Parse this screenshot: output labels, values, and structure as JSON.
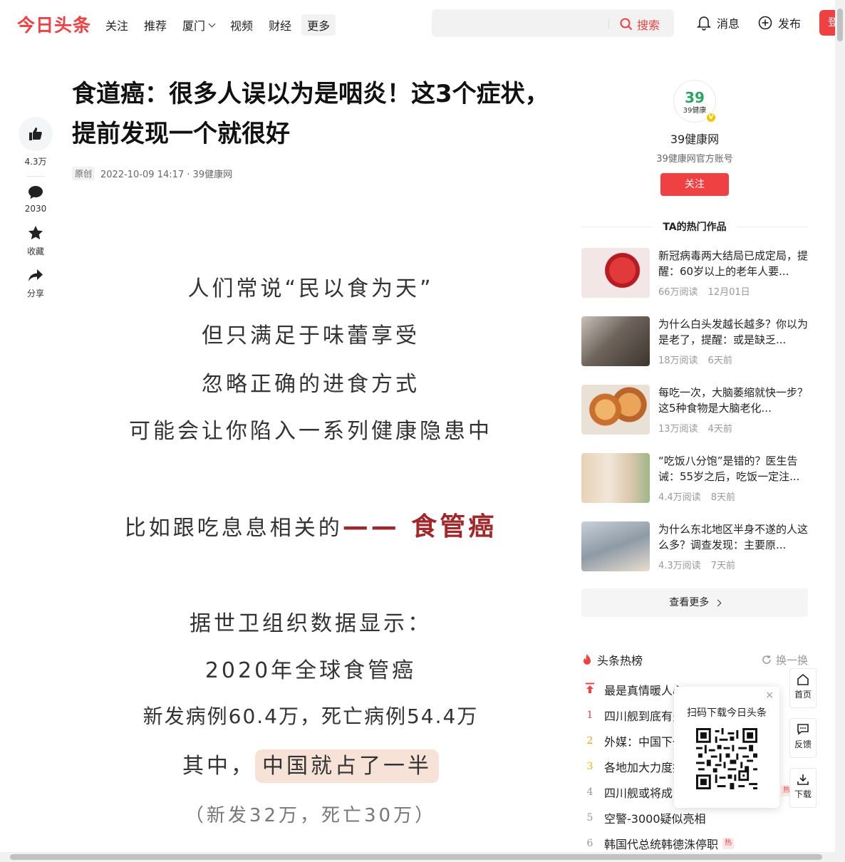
{
  "header": {
    "logo": "今日头条",
    "nav": [
      {
        "label": "关注"
      },
      {
        "label": "推荐"
      },
      {
        "label": "厦门"
      },
      {
        "label": "视频"
      },
      {
        "label": "财经"
      },
      {
        "label": "更多"
      }
    ],
    "search_button": "搜索",
    "messages": "消息",
    "publish": "发布",
    "login": "登"
  },
  "actions": {
    "like_count": "4.3万",
    "comment_count": "2030",
    "collect": "收藏",
    "share": "分享"
  },
  "article": {
    "title": "食道癌：很多人误以为是咽炎！这3个症状，提前发现一个就很好",
    "tag": "原创",
    "meta": "2022-10-09 14:17 · 39健康网",
    "poster": {
      "l1": "人们常说“民以食为天”",
      "l2": "但只满足于味蕾享受",
      "l3": "忽略正确的进食方式",
      "l4": "可能会让你陷入一系列健康隐患中",
      "l5_prefix": "比如跟吃息息相关的",
      "l5_red": "—— 食管癌",
      "l6": "据世卫组织数据显示：",
      "l7": "2020年全球食管癌",
      "l8": "新发病例60.4万，死亡病例54.4万",
      "l9_prefix": "其中，",
      "l9_hl": "中国就占了一半",
      "l10": "（新发32万，死亡30万）"
    }
  },
  "author": {
    "avatar_text": "39健康",
    "name": "39健康网",
    "desc": "39健康网官方账号",
    "follow": "关注",
    "hot_works_title": "TA的热门作品",
    "works": [
      {
        "title": "新冠病毒两大结局已成定局，提醒：60岁以上的老年人要...",
        "reads": "66万阅读",
        "time": "12月01日",
        "color": "#c0262a"
      },
      {
        "title": "为什么白头发越长越多？你以为是老了，提醒：或是缺乏...",
        "reads": "18万阅读",
        "time": "6天前",
        "color": "#6e645c"
      },
      {
        "title": "每吃一次，大脑萎缩就快一步？这5种食物是大脑老化...",
        "reads": "13万阅读",
        "time": "4天前",
        "color": "#d98a3c"
      },
      {
        "title": "“吃饭八分饱”是错的？医生告诫：55岁之后，吃饭一定注...",
        "reads": "4.4万阅读",
        "time": "8天前",
        "color": "#b9a27e"
      },
      {
        "title": "为什么东北地区半身不遂的人这么多？调查发现：主要原...",
        "reads": "4.3万阅读",
        "time": "7天前",
        "color": "#8e9aa6"
      }
    ],
    "more": "查看更多"
  },
  "board": {
    "title": "头条热榜",
    "refresh": "换一换",
    "items": [
      {
        "no": "",
        "text": "最是真情暖人心"
      },
      {
        "no": "1",
        "text": "四川舰到底有多"
      },
      {
        "no": "2",
        "text": "外媒：中国下一"
      },
      {
        "no": "3",
        "text": "各地加大力度抗"
      },
      {
        "no": "4",
        "text": "四川舰或将成"
      },
      {
        "no": "5",
        "text": "空警-3000疑似亮相"
      },
      {
        "no": "6",
        "text": "韩国代总统韩德洙停职"
      }
    ],
    "hot_badge": "热"
  },
  "qr_popup": {
    "title": "扫码下载今日头条",
    "close": "×"
  },
  "side": {
    "home": "首页",
    "feedback": "反馈",
    "download": "下载"
  }
}
